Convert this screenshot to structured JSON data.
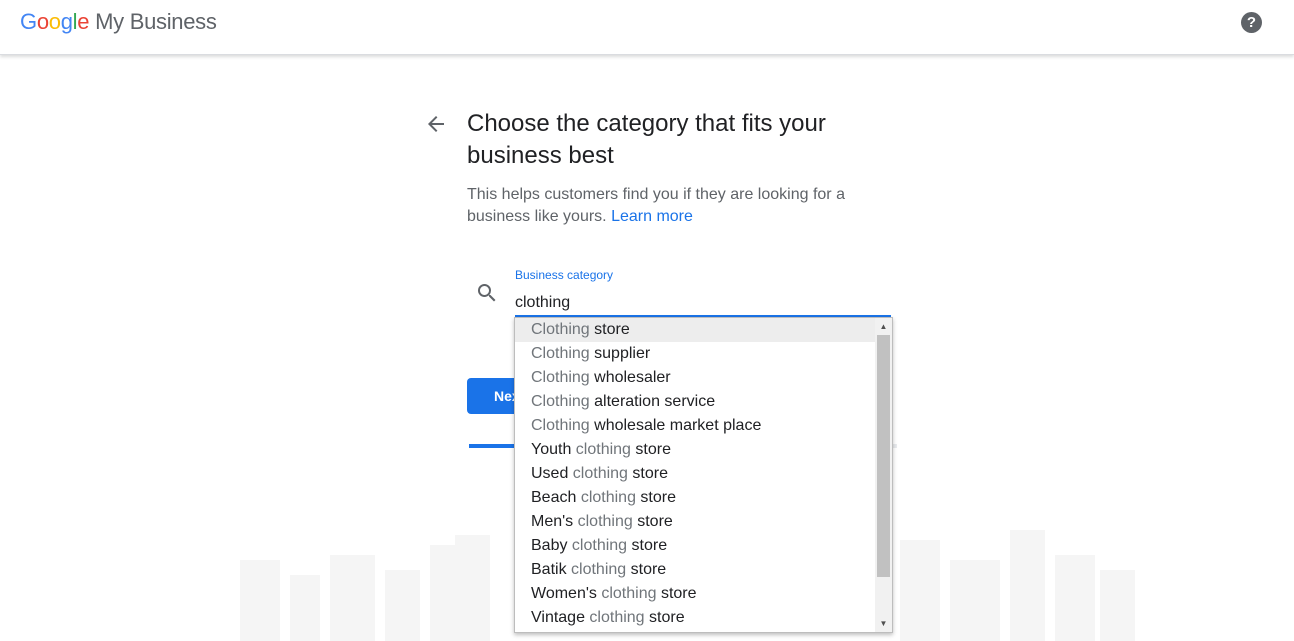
{
  "header": {
    "logo_letters": [
      "G",
      "o",
      "o",
      "g",
      "l",
      "e"
    ],
    "product": "My Business",
    "help_glyph": "?"
  },
  "page": {
    "title": "Choose the category that fits your business best",
    "subtitle": "This helps customers find you if they are looking for a business like yours.",
    "learn_more": "Learn more"
  },
  "search": {
    "label": "Business category",
    "value": "clothing"
  },
  "actions": {
    "next_label": "Next"
  },
  "progress": {
    "fraction": 0.32
  },
  "suggestions": [
    {
      "pre": "",
      "match": "Clothing",
      "post": " store"
    },
    {
      "pre": "",
      "match": "Clothing",
      "post": " supplier"
    },
    {
      "pre": "",
      "match": "Clothing",
      "post": " wholesaler"
    },
    {
      "pre": "",
      "match": "Clothing",
      "post": " alteration service"
    },
    {
      "pre": "",
      "match": "Clothing",
      "post": " wholesale market place"
    },
    {
      "pre": "Youth ",
      "match": "clothing",
      "post": " store"
    },
    {
      "pre": "Used ",
      "match": "clothing",
      "post": " store"
    },
    {
      "pre": "Beach ",
      "match": "clothing",
      "post": " store"
    },
    {
      "pre": "Men's ",
      "match": "clothing",
      "post": " store"
    },
    {
      "pre": "Baby ",
      "match": "clothing",
      "post": " store"
    },
    {
      "pre": "Batik ",
      "match": "clothing",
      "post": " store"
    },
    {
      "pre": "Women's ",
      "match": "clothing",
      "post": " store"
    },
    {
      "pre": "Vintage ",
      "match": "clothing",
      "post": " store"
    }
  ],
  "icons": {
    "back": "arrow-back-icon",
    "search": "search-icon",
    "help": "help-icon"
  },
  "colors": {
    "accent": "#1a73e8",
    "match_text": "#70757a",
    "dark_text": "#202124"
  }
}
